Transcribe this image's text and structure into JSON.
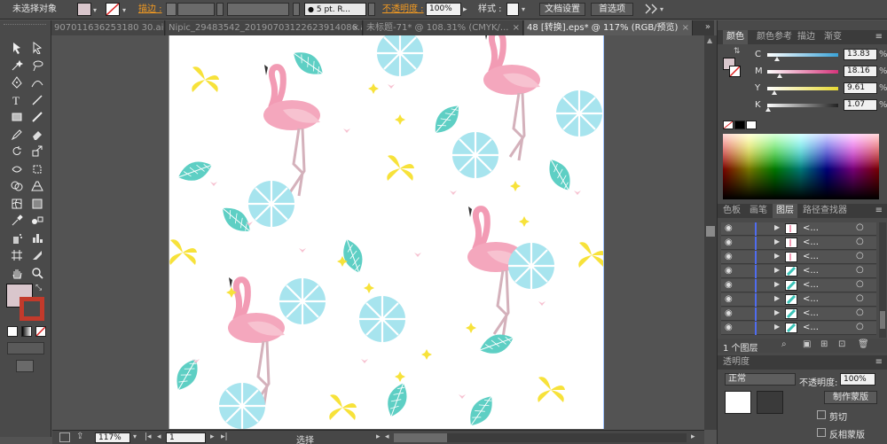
{
  "control_bar": {
    "selection_status": "未选择对象",
    "fill_color": "#d9c6cc",
    "stroke_label": "描边 :",
    "stroke_width_unit": "",
    "brush_preset": "5 pt. R...",
    "opacity_label": "不透明度 :",
    "opacity_value": "100%",
    "style_label": "样式 :",
    "doc_setup_button": "文档设置",
    "preferences_button": "首选项"
  },
  "document_tabs": [
    {
      "label": "907011636253180 30.ai*",
      "active": false
    },
    {
      "label": "Nipic_29483542_20190703122623914086.ai*",
      "active": false
    },
    {
      "label": "未标题-71* @ 108.31% (CMYK/...",
      "active": false
    },
    {
      "label": "48 [转换].eps* @ 117% (RGB/预览)",
      "active": true
    }
  ],
  "tools": [
    "selection-icon",
    "direct-selection-icon",
    "magic-wand-icon",
    "lasso-icon",
    "pen-icon",
    "curvature-icon",
    "type-icon",
    "line-icon",
    "rectangle-icon",
    "paintbrush-icon",
    "pencil-icon",
    "eraser-icon",
    "rotate-icon",
    "scale-icon",
    "width-icon",
    "free-transform-icon",
    "shape-builder-icon",
    "perspective-grid-icon",
    "mesh-icon",
    "gradient-icon",
    "eyedropper-icon",
    "blend-icon",
    "symbol-sprayer-icon",
    "column-graph-icon",
    "artboard-icon",
    "slice-icon",
    "hand-icon",
    "zoom-icon"
  ],
  "toolbox_colors": {
    "fill": "#d9c6cc",
    "stroke": "#c0392b"
  },
  "color_panel": {
    "tabs": [
      "颜色",
      "颜色参考",
      "描边",
      "渐变"
    ],
    "active_tab": "颜色",
    "channels": [
      {
        "name": "C",
        "value": "13.83",
        "color": "#3aa3d8",
        "level": 0.14
      },
      {
        "name": "M",
        "value": "18.16",
        "color": "#d6337a",
        "level": 0.18
      },
      {
        "name": "Y",
        "value": "9.61",
        "color": "#e6d832",
        "level": 0.1
      },
      {
        "name": "K",
        "value": "1.07",
        "color": "#222222",
        "level": 0.01
      }
    ]
  },
  "layers_panel": {
    "tabs": [
      "色板",
      "画笔",
      "图层",
      "路径查找器"
    ],
    "active_tab": "图层",
    "rows": [
      {
        "name": "<...",
        "thumb": "flamingo"
      },
      {
        "name": "<...",
        "thumb": "flamingo"
      },
      {
        "name": "<...",
        "thumb": "flamingo"
      },
      {
        "name": "<...",
        "thumb": "leaf"
      },
      {
        "name": "<...",
        "thumb": "leaf"
      },
      {
        "name": "<...",
        "thumb": "leaf"
      },
      {
        "name": "<...",
        "thumb": "leaf"
      },
      {
        "name": "<...",
        "thumb": "leaf"
      }
    ],
    "footer_count": "1 个图层"
  },
  "transparency_panel": {
    "title": "透明度",
    "mode": "正常",
    "opacity": "100%",
    "make_mask": "制作蒙版",
    "clip": "剪切",
    "invert_mask": "反相蒙版"
  },
  "status_bar": {
    "zoom": "117%",
    "artboard": "1",
    "tool": "选择"
  }
}
